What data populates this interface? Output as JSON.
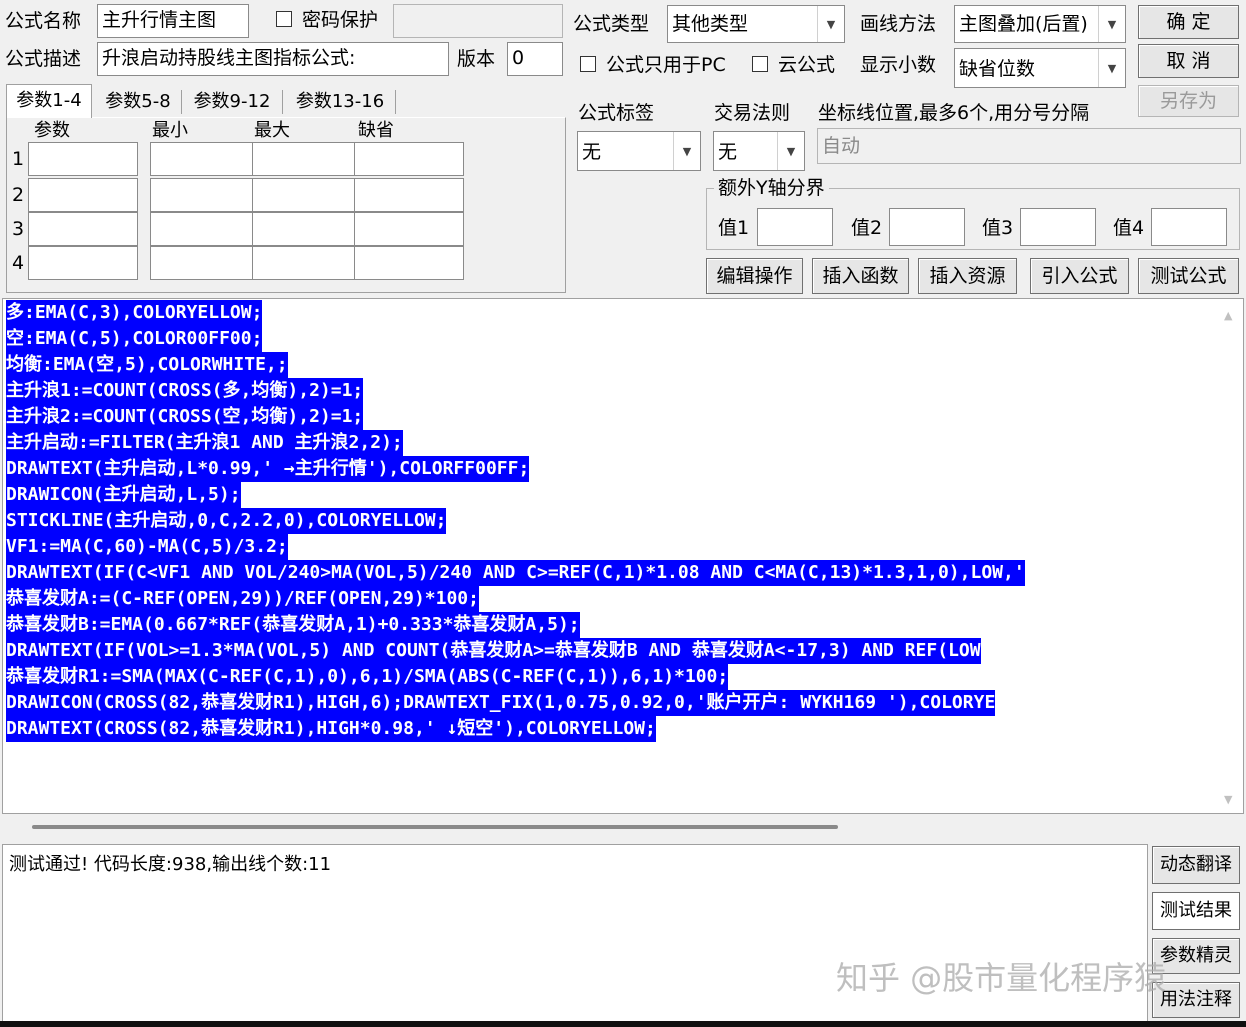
{
  "top": {
    "name_label": "公式名称",
    "name_value": "主升行情主图",
    "password_label": "密码保护",
    "desc_label": "公式描述",
    "desc_value": "升浪启动持股线主图指标公式:",
    "version_label": "版本",
    "version_value": "0",
    "type_label": "公式类型",
    "type_value": "其他类型",
    "draw_label": "画线方法",
    "draw_value": "主图叠加(后置)",
    "pc_only_label": "公式只用于PC",
    "cloud_label": "云公式",
    "decimals_label": "显示小数",
    "decimals_value": "缺省位数",
    "ok_button": "确 定",
    "cancel_button": "取 消",
    "saveas_button": "另存为"
  },
  "params": {
    "tabs": [
      "参数1-4",
      "参数5-8",
      "参数9-12",
      "参数13-16"
    ],
    "headers": [
      "参数",
      "最小",
      "最大",
      "缺省"
    ],
    "rows": [
      "1",
      "2",
      "3",
      "4"
    ]
  },
  "right": {
    "tag_label": "公式标签",
    "tag_value": "无",
    "rule_label": "交易法则",
    "rule_value": "无",
    "coord_label": "坐标线位置,最多6个,用分号分隔",
    "coord_value": "自动",
    "yaxis_group": "额外Y轴分界",
    "v1": "值1",
    "v2": "值2",
    "v3": "值3",
    "v4": "值4"
  },
  "actions": [
    "编辑操作",
    "插入函数",
    "插入资源",
    "引入公式",
    "测试公式"
  ],
  "code": [
    "多:EMA(C,3),COLORYELLOW;",
    "空:EMA(C,5),COLOR00FF00;",
    "均衡:EMA(空,5),COLORWHITE,;",
    "主升浪1:=COUNT(CROSS(多,均衡),2)=1;",
    "主升浪2:=COUNT(CROSS(空,均衡),2)=1;",
    "主升启动:=FILTER(主升浪1 AND 主升浪2,2);",
    "DRAWTEXT(主升启动,L*0.99,' →主升行情'),COLORFF00FF;",
    "DRAWICON(主升启动,L,5);",
    "STICKLINE(主升启动,0,C,2.2,0),COLORYELLOW;",
    "VF1:=MA(C,60)-MA(C,5)/3.2;",
    "DRAWTEXT(IF(C<VF1 AND VOL/240>MA(VOL,5)/240 AND C>=REF(C,1)*1.08 AND C<MA(C,13)*1.3,1,0),LOW,'",
    "恭喜发财A:=(C-REF(OPEN,29))/REF(OPEN,29)*100;",
    "恭喜发财B:=EMA(0.667*REF(恭喜发财A,1)+0.333*恭喜发财A,5);",
    "DRAWTEXT(IF(VOL>=1.3*MA(VOL,5) AND COUNT(恭喜发财A>=恭喜发财B AND 恭喜发财A<-17,3) AND REF(LOW",
    "恭喜发财R1:=SMA(MAX(C-REF(C,1),0),6,1)/SMA(ABS(C-REF(C,1)),6,1)*100;",
    "DRAWICON(CROSS(82,恭喜发财R1),HIGH,6);DRAWTEXT_FIX(1,0.75,0.92,0,'账户开户: WYKH169 '),COLORYE",
    "DRAWTEXT(CROSS(82,恭喜发财R1),HIGH*0.98,' ↓短空'),COLORYELLOW;"
  ],
  "output": {
    "message": "测试通过! 代码长度:938,输出线个数:11"
  },
  "side_buttons": [
    "动态翻译",
    "测试结果",
    "参数精灵",
    "用法注释"
  ],
  "watermark": "知乎 @股市量化程序猿"
}
